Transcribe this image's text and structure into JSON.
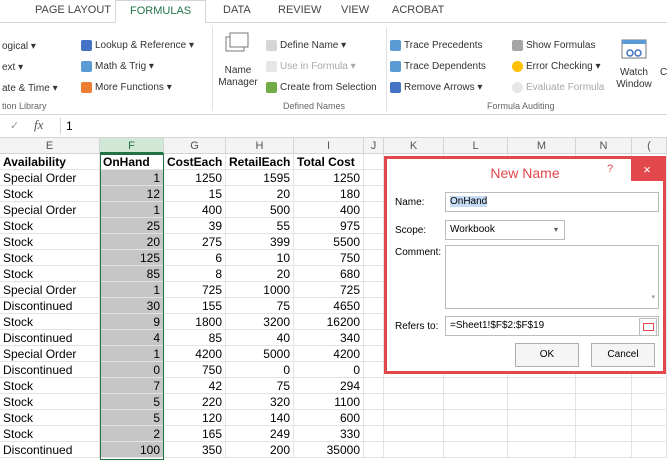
{
  "tabs": [
    "PAGE LAYOUT",
    "FORMULAS",
    "DATA",
    "REVIEW",
    "VIEW",
    "ACROBAT"
  ],
  "ribbon": {
    "library": {
      "items": [
        "ogical ▾",
        "ext ▾",
        "ate & Time ▾"
      ],
      "items2": [
        "Lookup & Reference ▾",
        "Math & Trig ▾",
        "More Functions ▾"
      ],
      "label": "tion Library"
    },
    "defined_names": {
      "name_manager": "Name\nManager",
      "define_name": "Define Name ▾",
      "use_in_formula": "Use in Formula ▾",
      "create_from_selection": "Create from Selection",
      "label": "Defined Names"
    },
    "auditing": {
      "trace_precedents": "Trace Precedents",
      "trace_dependents": "Trace Dependents",
      "remove_arrows": "Remove Arrows ▾",
      "show_formulas": "Show Formulas",
      "error_checking": "Error Checking ▾",
      "evaluate_formula": "Evaluate Formula",
      "label": "Formula Auditing"
    },
    "watch_window": "Watch\nWindow"
  },
  "formula_bar": {
    "fx": "fx",
    "value": "1"
  },
  "columns": [
    "E",
    "F",
    "G",
    "H",
    "I",
    "J",
    "K",
    "L",
    "M",
    "N",
    "("
  ],
  "header_row": [
    "Availability",
    "OnHand",
    "CostEach",
    "RetailEach",
    "Total Cost"
  ],
  "rows": [
    [
      "Special Order",
      "1",
      "1250",
      "1595",
      "1250"
    ],
    [
      "Stock",
      "12",
      "15",
      "20",
      "180"
    ],
    [
      "Special Order",
      "1",
      "400",
      "500",
      "400"
    ],
    [
      "Stock",
      "25",
      "39",
      "55",
      "975"
    ],
    [
      "Stock",
      "20",
      "275",
      "399",
      "5500"
    ],
    [
      "Stock",
      "125",
      "6",
      "10",
      "750"
    ],
    [
      "Stock",
      "85",
      "8",
      "20",
      "680"
    ],
    [
      "Special Order",
      "1",
      "725",
      "1000",
      "725"
    ],
    [
      "Discontinued",
      "30",
      "155",
      "75",
      "4650"
    ],
    [
      "Stock",
      "9",
      "1800",
      "3200",
      "16200"
    ],
    [
      "Discontinued",
      "4",
      "85",
      "40",
      "340"
    ],
    [
      "Special Order",
      "1",
      "4200",
      "5000",
      "4200"
    ],
    [
      "Discontinued",
      "0",
      "750",
      "0",
      "0"
    ],
    [
      "Stock",
      "7",
      "42",
      "75",
      "294"
    ],
    [
      "Stock",
      "5",
      "220",
      "320",
      "1100"
    ],
    [
      "Stock",
      "5",
      "120",
      "140",
      "600"
    ],
    [
      "Stock",
      "2",
      "165",
      "249",
      "330"
    ],
    [
      "Discontinued",
      "100",
      "350",
      "200",
      "35000"
    ]
  ],
  "dialog": {
    "title": "New Name",
    "help": "?",
    "close": "×",
    "name_label": "Name:",
    "name_value": "OnHand",
    "scope_label": "Scope:",
    "scope_value": "Workbook",
    "comment_label": "Comment:",
    "refers_label": "Refers to:",
    "refers_value": "=Sheet1!$F$2:$F$19",
    "ok": "OK",
    "cancel": "Cancel"
  }
}
